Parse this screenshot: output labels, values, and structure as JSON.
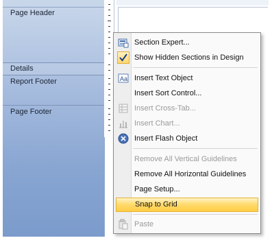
{
  "sections": {
    "page_header": "Page Header",
    "details": "Details",
    "report_footer": "Report Footer",
    "page_footer": "Page Footer"
  },
  "menu": {
    "items": [
      {
        "label": "Section Expert...",
        "enabled": true,
        "icon": "section-expert-icon"
      },
      {
        "label": "Show Hidden Sections in Design",
        "enabled": true,
        "icon": "checkmark-icon",
        "checked": true
      },
      {
        "label": "Insert Text Object",
        "enabled": true,
        "icon": "text-object-icon"
      },
      {
        "label": "Insert Sort Control...",
        "enabled": true,
        "icon": ""
      },
      {
        "label": "Insert Cross-Tab...",
        "enabled": false,
        "icon": "cross-tab-icon"
      },
      {
        "label": "Insert Chart...",
        "enabled": false,
        "icon": "chart-icon"
      },
      {
        "label": "Insert Flash Object",
        "enabled": true,
        "icon": "flash-object-icon"
      },
      {
        "label": "Remove All Vertical Guidelines",
        "enabled": false,
        "icon": ""
      },
      {
        "label": "Remove All Horizontal Guidelines",
        "enabled": true,
        "icon": ""
      },
      {
        "label": "Page Setup...",
        "enabled": true,
        "icon": ""
      },
      {
        "label": "Snap to Grid",
        "enabled": true,
        "icon": "",
        "highlighted": true
      },
      {
        "label": "Paste",
        "enabled": false,
        "icon": "paste-icon"
      }
    ]
  },
  "colors": {
    "highlight": "#ffd96b",
    "checkmark": "#1a3a8a",
    "disabled_text": "#9a9a9a"
  }
}
